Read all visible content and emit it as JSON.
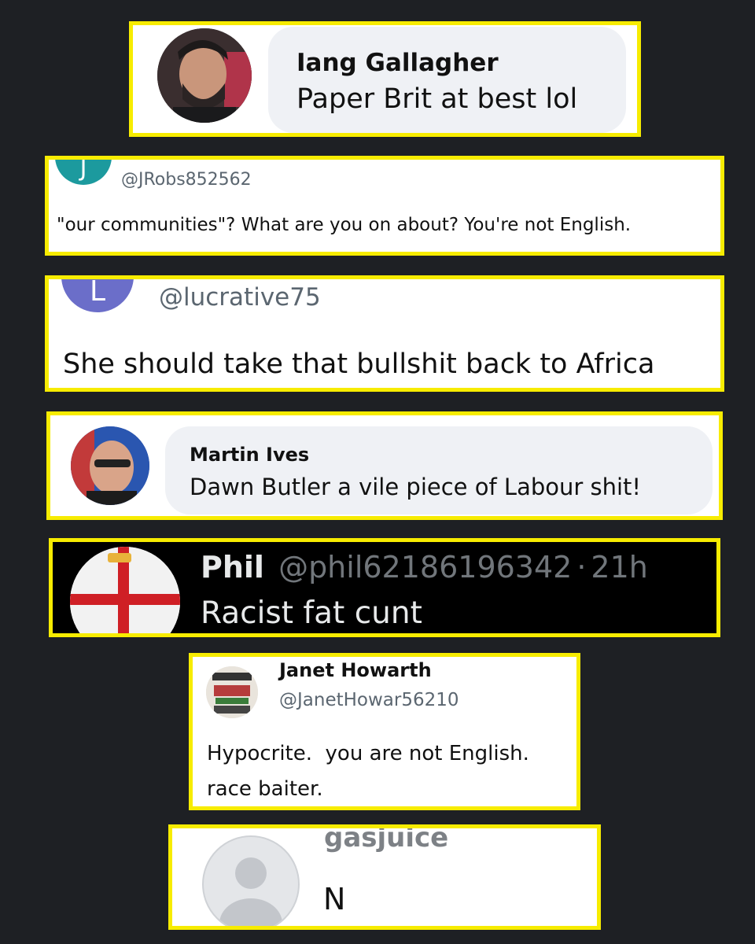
{
  "comments": [
    {
      "name": "Iang Gallagher",
      "text": "Paper Brit at best lol"
    },
    {
      "handle": "@JRobs852562",
      "avatar_letter": "J",
      "text": "\"our communities\"? What are you on about? You're not English."
    },
    {
      "handle": "@lucrative75",
      "avatar_letter": "L",
      "text": "She should take that bullshit back to Africa"
    },
    {
      "name": "Martin Ives",
      "text": "Dawn Butler a vile piece of Labour shit!"
    },
    {
      "name": "Phil",
      "handle": "@phil62186196342",
      "sep": "·",
      "time": "21h",
      "text": "Racist fat cunt"
    },
    {
      "name": "Janet Howarth",
      "handle": "@JanetHowar56210",
      "text_line1": "Hypocrite.  you are not English.",
      "text_line2": "race baiter."
    },
    {
      "name": "gasjuice",
      "text": "N"
    }
  ],
  "colors": {
    "highlight": "#f7ec00",
    "background": "#1e2024",
    "avatar_teal": "#1c9a9e",
    "avatar_purple": "#6b6ec9",
    "flag_red": "#cf1f25"
  },
  "icons": [
    "user-avatar-placeholder",
    "england-flag-avatar",
    "photo-avatar"
  ]
}
